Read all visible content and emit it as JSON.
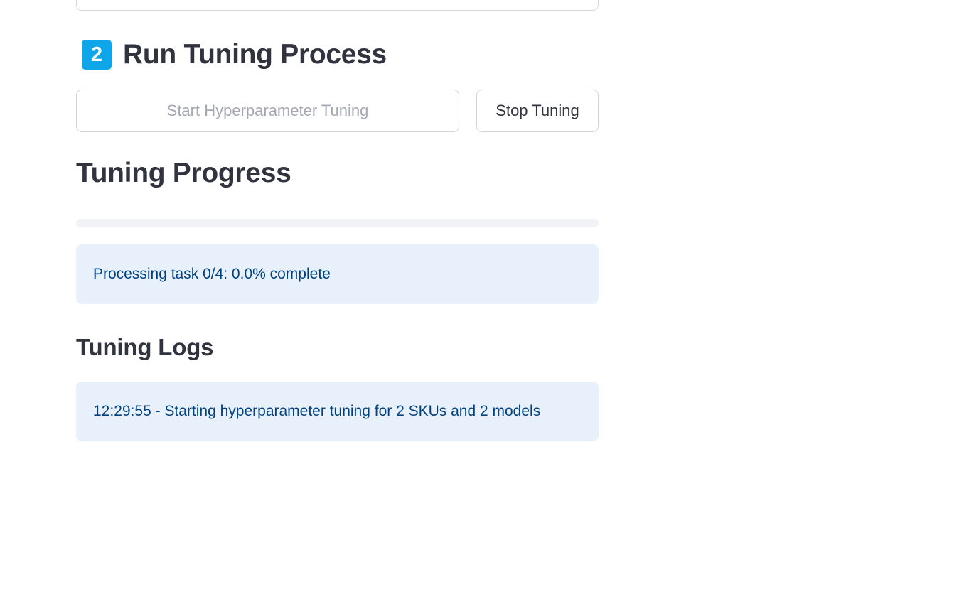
{
  "section": {
    "badge_number": "2",
    "title": "Run Tuning Process"
  },
  "buttons": {
    "start_label": "Start Hyperparameter Tuning",
    "stop_label": "Stop Tuning"
  },
  "progress": {
    "title": "Tuning Progress",
    "fraction": 0.0,
    "status_text": "Processing task 0/4: 0.0% complete"
  },
  "logs": {
    "title": "Tuning Logs",
    "entries": [
      "12:29:55 - Starting hyperparameter tuning for 2 SKUs and 2 models"
    ]
  },
  "colors": {
    "accent": "#0ea5e9",
    "info_background": "#e8f1fb",
    "info_text": "#004280",
    "text": "#31333f",
    "disabled_text": "#a3a8b4"
  }
}
